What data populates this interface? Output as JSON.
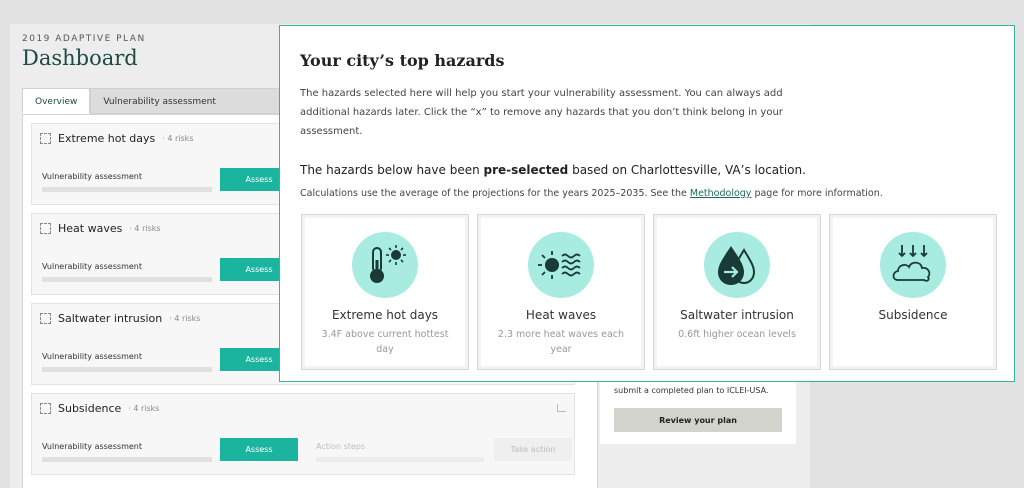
{
  "dashboard": {
    "eyebrow": "2019 ADAPTIVE PLAN",
    "title": "Dashboard",
    "tabs": [
      "Overview",
      "Vulnerability assessment"
    ],
    "hazards": [
      {
        "name": "Extreme hot days",
        "count": "· 4 risks"
      },
      {
        "name": "Heat waves",
        "count": "· 4 risks"
      },
      {
        "name": "Saltwater intrusion",
        "count": "· 4 risks"
      },
      {
        "name": "Subsidence",
        "count": "· 4 risks"
      }
    ],
    "va_label": "Vulnerability assessment",
    "assess_label": "Assess",
    "action_steps_label": "Action steps",
    "take_action_label": "Take action",
    "side_text": "submit a completed plan to ICLEI-USA.",
    "review_label": "Review your plan"
  },
  "modal": {
    "title": "Your city’s top hazards",
    "intro": "The hazards selected here will help you start your vulnerability assessment. You can always add additional hazards later. Click the “x” to remove any hazards that you don’t think belong in your assessment.",
    "presel_before": "The hazards below have been ",
    "presel_bold": "pre-selected",
    "presel_after": " based on Charlottesville, VA’s location.",
    "calc_before": "Calculations use the average of the projections for the years 2025–2035. See the ",
    "calc_link": "Methodology",
    "calc_after": " page for more information.",
    "hazards": [
      {
        "name": "Extreme hot days",
        "desc": "3.4F above current hottest day",
        "icon": "thermometer-sun-icon"
      },
      {
        "name": "Heat waves",
        "desc": "2.3 more heat waves each year",
        "icon": "sun-waves-icon"
      },
      {
        "name": "Saltwater intrusion",
        "desc": "0.6ft higher ocean levels",
        "icon": "water-drop-arrow-icon"
      },
      {
        "name": "Subsidence",
        "desc": "",
        "icon": "cloud-down-arrows-icon"
      }
    ]
  },
  "colors": {
    "accent": "#1bb59f",
    "modal_border": "#36b39b",
    "icon_circle": "#a7ebe1",
    "title_green": "#1d4a40"
  }
}
